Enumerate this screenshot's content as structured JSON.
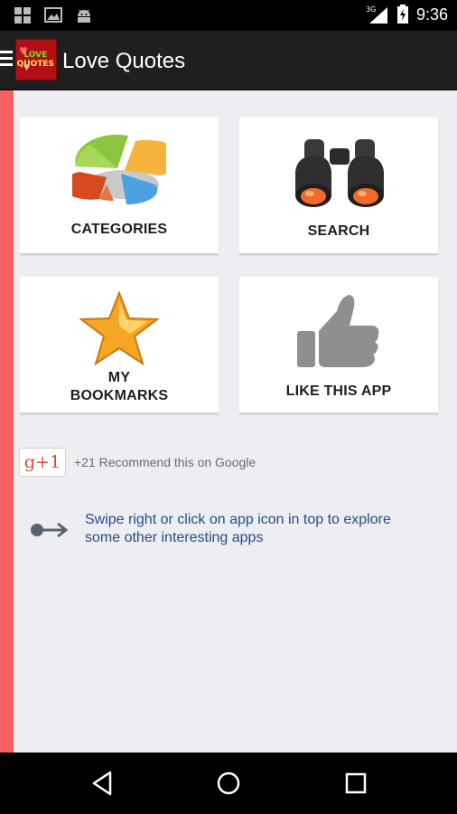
{
  "status_bar": {
    "time": "9:36",
    "network": "3G",
    "icons": [
      "photo-grid-icon",
      "image-icon",
      "android-icon",
      "signal-icon",
      "battery-charging-icon"
    ]
  },
  "action_bar": {
    "title": "Love Quotes",
    "logo_text_line1": "LOVE",
    "logo_text_line2": "QUOTES",
    "menu_icon": "hamburger-icon"
  },
  "tiles": [
    {
      "label": "CATEGORIES",
      "icon": "pie-chart-icon"
    },
    {
      "label": "SEARCH",
      "icon": "binoculars-icon"
    },
    {
      "label_line1": "MY",
      "label_line2": "BOOKMARKS",
      "icon": "star-icon"
    },
    {
      "label": "LIKE THIS APP",
      "icon": "thumbs-up-icon"
    }
  ],
  "gplus": {
    "button_label": "g+1",
    "text": "+21 Recommend this on Google"
  },
  "hint": {
    "icon": "swipe-arrow-icon",
    "text": "Swipe right or click on app icon in top to explore some other interesting apps"
  },
  "nav_bar": {
    "icons": [
      "back-icon",
      "home-icon",
      "recents-icon"
    ]
  },
  "colors": {
    "drawer_edge": "#ff5f5f",
    "action_bar": "#1f1f1f",
    "content_bg": "#eceef1",
    "hint_text": "#2a4a8a"
  }
}
